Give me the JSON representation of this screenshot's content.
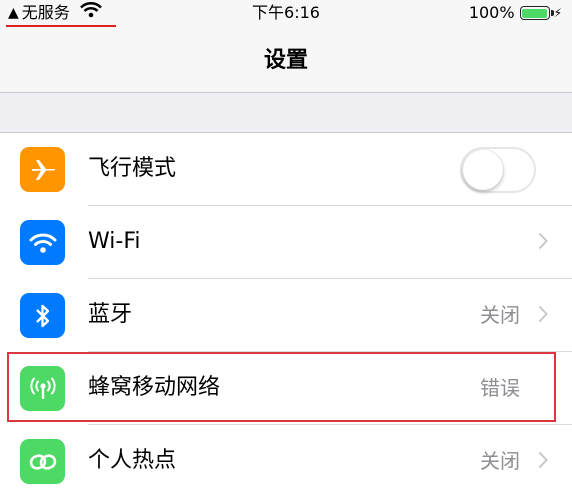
{
  "status_bar": {
    "carrier": "无服务",
    "time": "下午6:16",
    "battery": "100%"
  },
  "nav": {
    "title": "设置"
  },
  "settings": [
    {
      "label": "飞行模式",
      "value": "",
      "icon": "airplane-icon",
      "color": "#ff9500"
    },
    {
      "label": "Wi-Fi",
      "value": "",
      "icon": "wifi-icon",
      "color": "#007aff"
    },
    {
      "label": "蓝牙",
      "value": "关闭",
      "icon": "bluetooth-icon",
      "color": "#007aff"
    },
    {
      "label": "蜂窝移动网络",
      "value": "错误",
      "icon": "cellular-antenna-icon",
      "color": "#4cd964"
    },
    {
      "label": "个人热点",
      "value": "关闭",
      "icon": "hotspot-chain-icon",
      "color": "#4cd964"
    }
  ],
  "colors": {
    "highlight_frame": "#d9363e",
    "carrier_underline": "#e02020"
  }
}
